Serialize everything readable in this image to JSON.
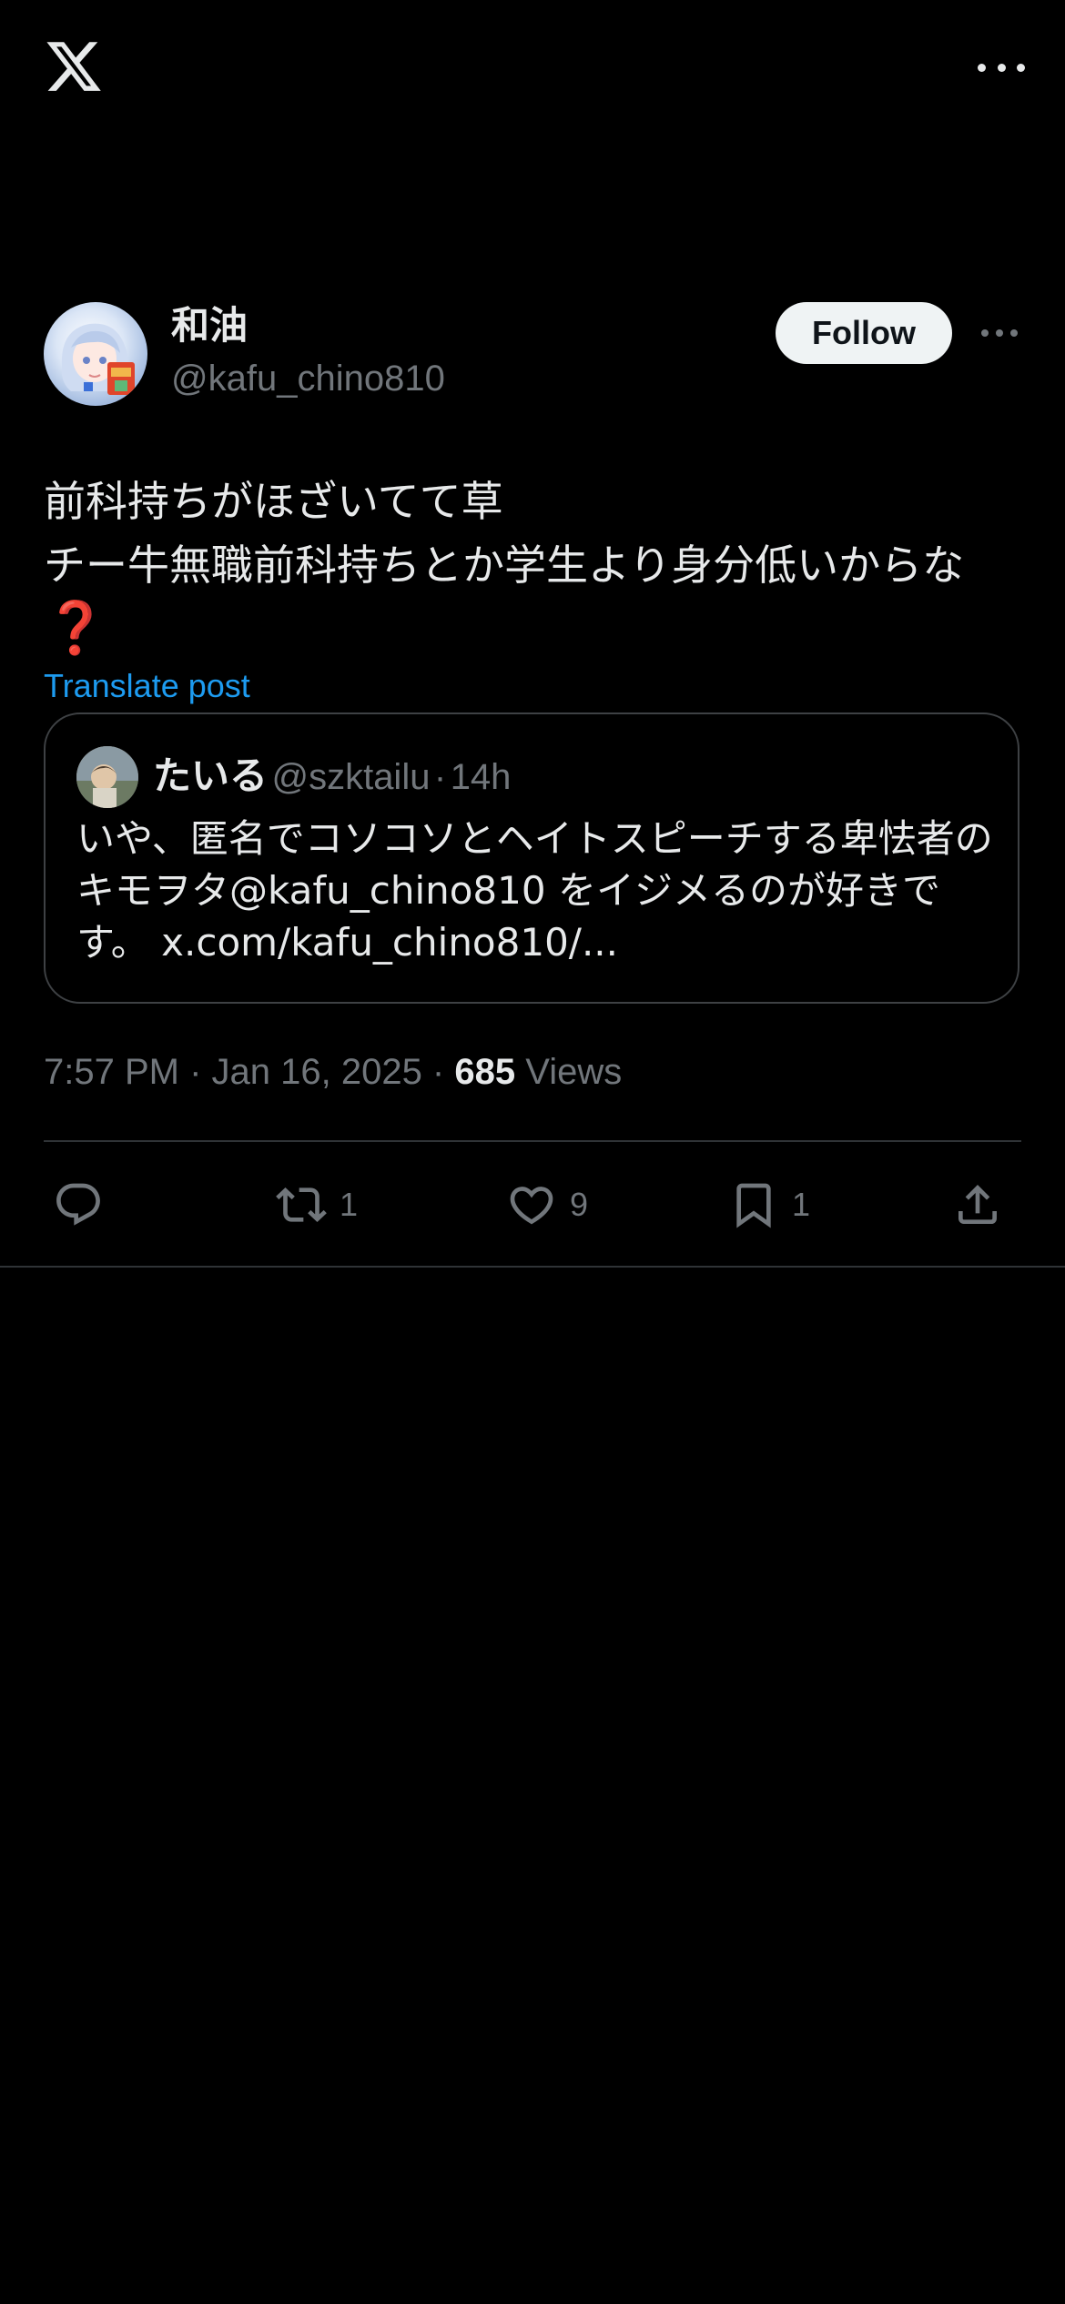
{
  "header": {
    "logo_icon": "x-logo-icon",
    "more_icon": "more-horizontal-icon"
  },
  "post": {
    "author": {
      "name": "和油",
      "handle": "@kafu_chino810"
    },
    "follow_label": "Follow",
    "text_line1": "前科持ちがほざいてて草",
    "text_line2": "チー牛無職前科持ちとか学生より身分低いからな",
    "emoji": "❓",
    "translate_label": "Translate post",
    "quote": {
      "name": "たいる",
      "handle": "@szktailu",
      "separator": "·",
      "time": "14h",
      "text": "いや、匿名でコソコソとヘイトスピーチする卑怯者のキモヲタ@kafu_chino810 をイジメるのが好きです。 x.com/kafu_chino810/..."
    },
    "timestamp": "7:57 PM · Jan 16, 2025 · ",
    "views_count": "685",
    "views_label": " Views",
    "actions": {
      "reply": {
        "icon": "reply-icon",
        "count": ""
      },
      "repost": {
        "icon": "repost-icon",
        "count": "1"
      },
      "like": {
        "icon": "heart-icon",
        "count": "9"
      },
      "bookmark": {
        "icon": "bookmark-icon",
        "count": "1"
      },
      "share": {
        "icon": "share-icon",
        "count": ""
      }
    }
  },
  "colors": {
    "background": "#000000",
    "text_primary": "#e7e9ea",
    "text_secondary": "#71767b",
    "accent_link": "#1d9bf0",
    "divider": "#2f3336",
    "emoji_red": "#d4233c"
  }
}
